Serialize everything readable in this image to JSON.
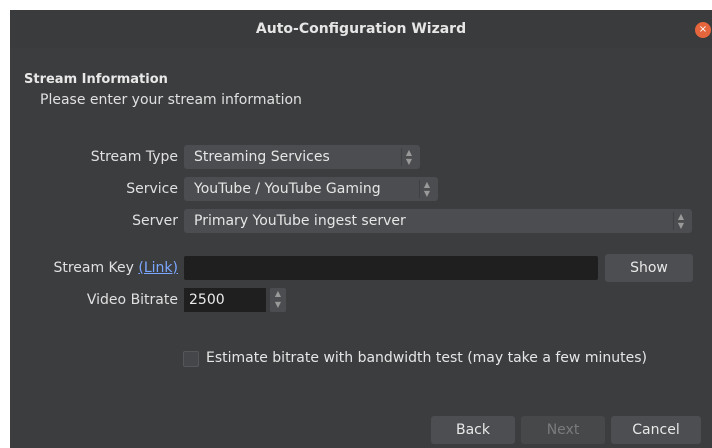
{
  "window": {
    "title": "Auto-Configuration Wizard",
    "close_glyph": "×"
  },
  "section": {
    "title": "Stream Information",
    "subtitle": "Please enter your stream information"
  },
  "form": {
    "stream_type": {
      "label": "Stream Type",
      "value": "Streaming Services"
    },
    "service": {
      "label": "Service",
      "value": "YouTube / YouTube Gaming"
    },
    "server": {
      "label": "Server",
      "value": "Primary YouTube ingest server"
    },
    "stream_key": {
      "label": "Stream Key",
      "link_text": "(Link)",
      "value": "",
      "show_button": "Show"
    },
    "video_bitrate": {
      "label": "Video Bitrate",
      "value": "2500"
    },
    "estimate_checkbox": {
      "label": "Estimate bitrate with bandwidth test (may take a few minutes)",
      "checked": false
    }
  },
  "buttons": {
    "back": "Back",
    "next": "Next",
    "cancel": "Cancel"
  },
  "icons": {
    "combo_arrows": "updown-arrows-icon",
    "close": "close-icon"
  },
  "colors": {
    "background": "#3c3d3f",
    "field_dark": "#1f1f20",
    "link": "#7aa7ff",
    "close": "#e5653d"
  }
}
